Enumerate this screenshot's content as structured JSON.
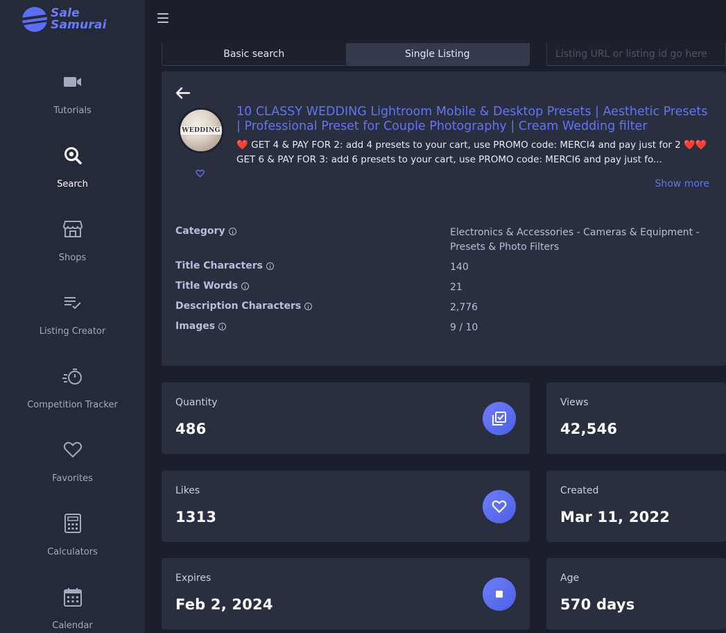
{
  "app": {
    "brand_line1": "Sale",
    "brand_line2": "Samurai",
    "accent": "#5b6ef5"
  },
  "sidebar": {
    "items": [
      {
        "label": "Tutorials",
        "icon": "video-camera-icon",
        "active": false
      },
      {
        "label": "Search",
        "icon": "search-icon",
        "active": true
      },
      {
        "label": "Shops",
        "icon": "store-icon",
        "active": false
      },
      {
        "label": "Listing Creator",
        "icon": "list-check-icon",
        "active": false
      },
      {
        "label": "Competition Tracker",
        "icon": "stopwatch-icon",
        "active": false
      },
      {
        "label": "Favorites",
        "icon": "heart-icon",
        "active": false
      },
      {
        "label": "Calculators",
        "icon": "calculator-icon",
        "active": false
      },
      {
        "label": "Calendar",
        "icon": "calendar-icon",
        "active": false
      }
    ]
  },
  "search": {
    "tabs": [
      {
        "label": "Basic search",
        "active": false
      },
      {
        "label": "Single Listing",
        "active": true
      }
    ],
    "url_placeholder": "Listing URL or listing id go here",
    "url_value": ""
  },
  "listing": {
    "thumbnail_text": "WEDDING",
    "title": "10 CLASSY WEDDING Lightroom Mobile & Desktop Presets | Aesthetic Presets | Professional Preset for Couple Photography | Cream Wedding filter",
    "desc_line1_emoji": "❤️",
    "desc_line1": "GET 4 & PAY FOR 2: add 4 presets to your cart, use PROMO code: MERCI4 and pay just for 2",
    "desc_line1_emoji_end": "❤️❤️",
    "desc_line2": "GET 6 & PAY FOR 3: add 6 presets to your cart, use PROMO code: MERCI6 and pay just fo...",
    "show_more": "Show more",
    "attributes": [
      {
        "label": "Category",
        "value": "Electronics & Accessories - Cameras & Equipment - Presets & Photo Filters"
      },
      {
        "label": "Title Characters",
        "value": "140"
      },
      {
        "label": "Title Words",
        "value": "21"
      },
      {
        "label": "Description Characters",
        "value": "2,776"
      },
      {
        "label": "Images",
        "value": "9 / 10"
      }
    ]
  },
  "stats": {
    "quantity": {
      "label": "Quantity",
      "value": "486",
      "icon": "checklist-icon"
    },
    "views": {
      "label": "Views",
      "value": "42,546"
    },
    "likes": {
      "label": "Likes",
      "value": "1313",
      "icon": "heart-icon"
    },
    "created": {
      "label": "Created",
      "value": "Mar 11, 2022"
    },
    "expires": {
      "label": "Expires",
      "value": "Feb 2, 2024",
      "icon": "stop-icon"
    },
    "age": {
      "label": "Age",
      "value": "570 days"
    }
  }
}
